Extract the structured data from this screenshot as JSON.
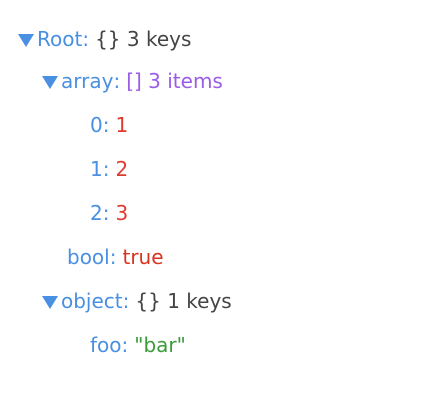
{
  "tree": {
    "root": {
      "key": "Root",
      "type_label": "{} 3 keys",
      "children": {
        "array": {
          "key": "array",
          "type_label": "[] 3 items",
          "items": [
            {
              "key": "0",
              "value": "1"
            },
            {
              "key": "1",
              "value": "2"
            },
            {
              "key": "2",
              "value": "3"
            }
          ]
        },
        "bool": {
          "key": "bool",
          "value": "true"
        },
        "object": {
          "key": "object",
          "type_label": "{} 1 keys",
          "items": [
            {
              "key": "foo",
              "value": "\"bar\""
            }
          ]
        }
      }
    }
  },
  "colors": {
    "key": "#4a90e2",
    "array_meta": "#9b5de5",
    "number": "#e03a2e",
    "boolean": "#d9341f",
    "string": "#3a9b3a"
  },
  "icons": {
    "expander": "triangle-down-icon"
  }
}
